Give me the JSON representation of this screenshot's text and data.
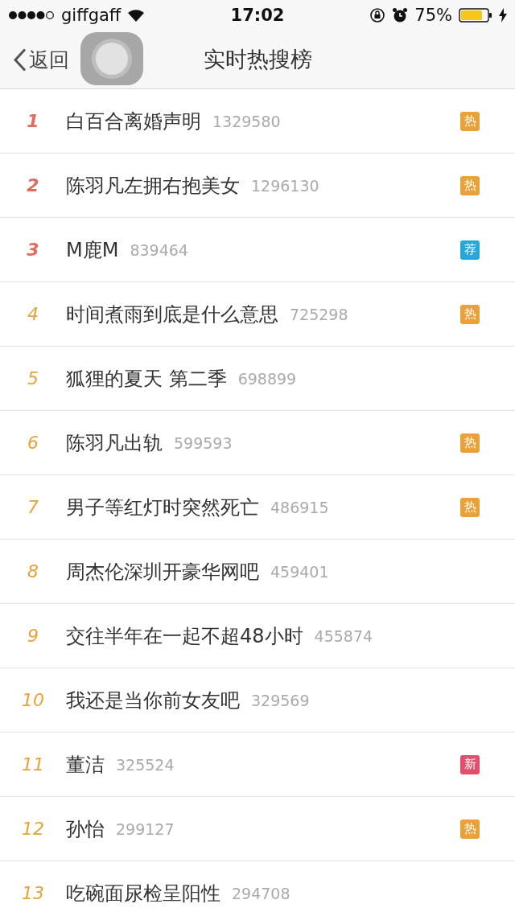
{
  "status_bar": {
    "carrier": "giffgaff",
    "time": "17:02",
    "battery": "75%"
  },
  "nav": {
    "back": "返回",
    "title": "实时热搜榜"
  },
  "items": [
    {
      "rank": "1",
      "color": "#e06b5e",
      "title": "白百合离婚声明",
      "count": "1329580",
      "badge": {
        "label": "热",
        "color": "#e9a139"
      }
    },
    {
      "rank": "2",
      "color": "#e06b5e",
      "title": "陈羽凡左拥右抱美女",
      "count": "1296130",
      "badge": {
        "label": "热",
        "color": "#e9a139"
      }
    },
    {
      "rank": "3",
      "color": "#e06b5e",
      "title": "M鹿M",
      "count": "839464",
      "badge": {
        "label": "荐",
        "color": "#2aa6d8"
      }
    },
    {
      "rank": "4",
      "color": "#e8a33a",
      "title": "时间煮雨到底是什么意思",
      "count": "725298",
      "badge": {
        "label": "热",
        "color": "#e9a139"
      }
    },
    {
      "rank": "5",
      "color": "#e8a33a",
      "title": "狐狸的夏天 第二季",
      "count": "698899"
    },
    {
      "rank": "6",
      "color": "#e8a33a",
      "title": "陈羽凡出轨",
      "count": "599593",
      "badge": {
        "label": "热",
        "color": "#e9a139"
      }
    },
    {
      "rank": "7",
      "color": "#e8a33a",
      "title": "男子等红灯时突然死亡",
      "count": "486915",
      "badge": {
        "label": "热",
        "color": "#e9a139"
      }
    },
    {
      "rank": "8",
      "color": "#e8a33a",
      "title": "周杰伦深圳开豪华网吧",
      "count": "459401"
    },
    {
      "rank": "9",
      "color": "#e8a33a",
      "title": "交往半年在一起不超48小时",
      "count": "455874"
    },
    {
      "rank": "10",
      "color": "#e8a33a",
      "title": "我还是当你前女友吧",
      "count": "329569"
    },
    {
      "rank": "11",
      "color": "#e8a33a",
      "title": "董洁",
      "count": "325524",
      "badge": {
        "label": "新",
        "color": "#e0506a"
      }
    },
    {
      "rank": "12",
      "color": "#e8a33a",
      "title": "孙怡",
      "count": "299127",
      "badge": {
        "label": "热",
        "color": "#e9a139"
      }
    },
    {
      "rank": "13",
      "color": "#e8a33a",
      "title": "吃碗面尿检呈阳性",
      "count": "294708"
    }
  ]
}
